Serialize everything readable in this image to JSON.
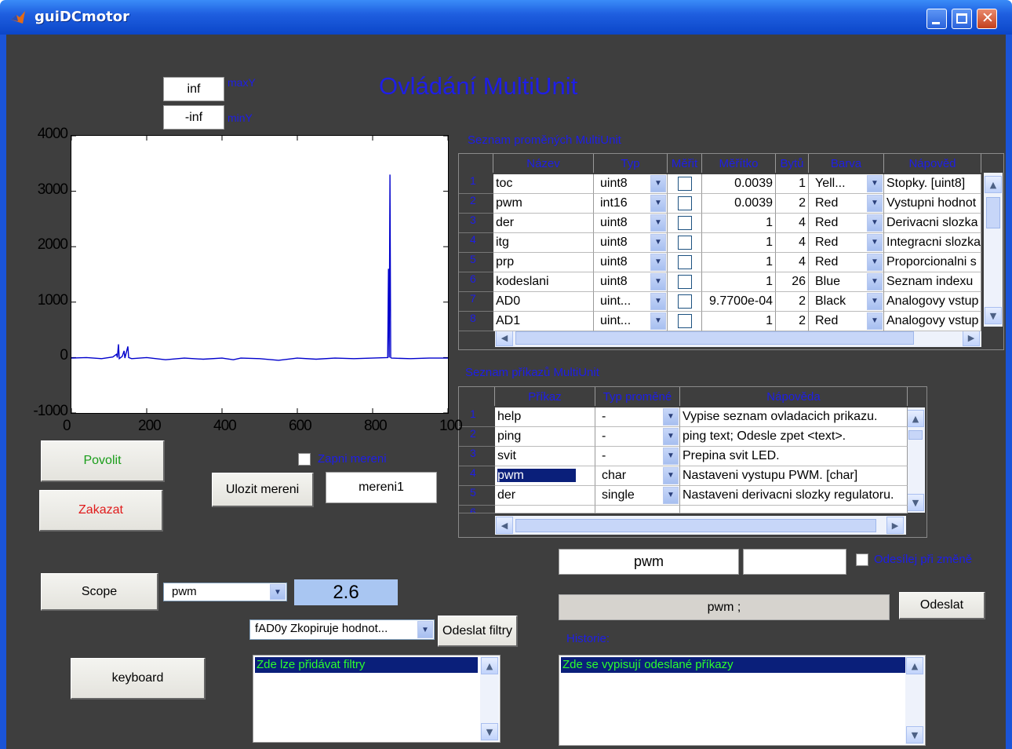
{
  "window": {
    "title": "guiDCmotor"
  },
  "heading": "Ovládání MultiUnit",
  "limits": {
    "max_value": "inf",
    "max_label": "maxY",
    "min_value": "-inf",
    "min_label": "minY"
  },
  "chart_data": {
    "type": "line",
    "ylim": [
      -1000,
      4000
    ],
    "xlim": [
      0,
      1000
    ],
    "yticks": [
      "4000",
      "3000",
      "2000",
      "1000",
      "0",
      "-1000"
    ],
    "xticks": [
      "0",
      "200",
      "400",
      "600",
      "800",
      "100"
    ],
    "series": [
      {
        "color": "#0000cc",
        "points": [
          [
            0,
            -10
          ],
          [
            40,
            0
          ],
          [
            80,
            -20
          ],
          [
            110,
            10
          ],
          [
            120,
            60
          ],
          [
            122,
            0
          ],
          [
            125,
            240
          ],
          [
            127,
            -20
          ],
          [
            135,
            20
          ],
          [
            140,
            120
          ],
          [
            142,
            -10
          ],
          [
            150,
            200
          ],
          [
            152,
            0
          ],
          [
            160,
            -20
          ],
          [
            200,
            0
          ],
          [
            250,
            -40
          ],
          [
            300,
            -10
          ],
          [
            350,
            -30
          ],
          [
            400,
            -10
          ],
          [
            430,
            -40
          ],
          [
            450,
            -10
          ],
          [
            500,
            -20
          ],
          [
            550,
            -50
          ],
          [
            600,
            -10
          ],
          [
            650,
            -30
          ],
          [
            700,
            -10
          ],
          [
            750,
            -20
          ],
          [
            800,
            -10
          ],
          [
            840,
            0
          ],
          [
            842,
            1600
          ],
          [
            844,
            0
          ],
          [
            846,
            3300
          ],
          [
            848,
            0
          ],
          [
            850,
            -10
          ],
          [
            900,
            -20
          ],
          [
            950,
            -10
          ],
          [
            1000,
            -10
          ]
        ]
      }
    ]
  },
  "buttons": {
    "enable": "Povolit",
    "disable": "Zakazat",
    "save": "Ulozit mereni",
    "scope": "Scope",
    "keyboard": "keyboard",
    "send_filters": "Odeslat filtry",
    "send": "Odeslat"
  },
  "measure": {
    "checkbox_label": "Zapni mereni",
    "filename": "mereni1"
  },
  "scope": {
    "selected": "pwm",
    "value": "2.6"
  },
  "filter": {
    "selected": "fAD0y Zkopiruje hodnot...",
    "list_item": "Zde lze přidávat filtry"
  },
  "vars": {
    "title": "Seznam proměných MultiUnit",
    "headers": [
      "Název",
      "Typ",
      "Měřit",
      "Měřítko",
      "Bytů",
      "Barva",
      "Nápověd"
    ],
    "rows": [
      {
        "n": "1",
        "name": "toc",
        "type": "uint8",
        "scale": "0.0039",
        "bytes": "1",
        "color": "Yell...",
        "help": "Stopky. [uint8]"
      },
      {
        "n": "2",
        "name": "pwm",
        "type": "int16",
        "scale": "0.0039",
        "bytes": "2",
        "color": "Red",
        "help": "Vystupni hodnot"
      },
      {
        "n": "3",
        "name": "der",
        "type": "uint8",
        "scale": "1",
        "bytes": "4",
        "color": "Red",
        "help": "Derivacni slozka"
      },
      {
        "n": "4",
        "name": "itg",
        "type": "uint8",
        "scale": "1",
        "bytes": "4",
        "color": "Red",
        "help": "Integracni slozka"
      },
      {
        "n": "5",
        "name": "prp",
        "type": "uint8",
        "scale": "1",
        "bytes": "4",
        "color": "Red",
        "help": "Proporcionalni s"
      },
      {
        "n": "6",
        "name": "kodeslani",
        "type": "uint8",
        "scale": "1",
        "bytes": "26",
        "color": "Blue",
        "help": "Seznam indexu"
      },
      {
        "n": "7",
        "name": "AD0",
        "type": "uint...",
        "scale": "9.7700e-04",
        "bytes": "2",
        "color": "Black",
        "help": "Analogovy vstup"
      },
      {
        "n": "8",
        "name": "AD1",
        "type": "uint...",
        "scale": "1",
        "bytes": "2",
        "color": "Red",
        "help": "Analogovy vstup"
      }
    ]
  },
  "cmds": {
    "title": "Seznam příkazů MultiUnit",
    "headers": [
      "Příkaz",
      "Typ proměné",
      "Nápověda"
    ],
    "rows": [
      {
        "n": "1",
        "cmd": "help",
        "type": "-",
        "help": "Vypise seznam ovladacich prikazu."
      },
      {
        "n": "2",
        "cmd": "ping",
        "type": "-",
        "help": "ping text; Odesle zpet <text>."
      },
      {
        "n": "3",
        "cmd": "svit",
        "type": "-",
        "help": "Prepina svit LED."
      },
      {
        "n": "4",
        "cmd": "pwm",
        "type": "char",
        "help": "Nastaveni vystupu PWM. [char]"
      },
      {
        "n": "5",
        "cmd": "der",
        "type": "single",
        "help": "Nastaveni derivacni slozky regulatoru."
      }
    ]
  },
  "command": {
    "name": "pwm",
    "arg": "",
    "send_on_change": "Odesílej při změně",
    "preview": "pwm ;"
  },
  "history": {
    "label": "Historie:",
    "item": "Zde se vypisují odeslané příkazy"
  }
}
